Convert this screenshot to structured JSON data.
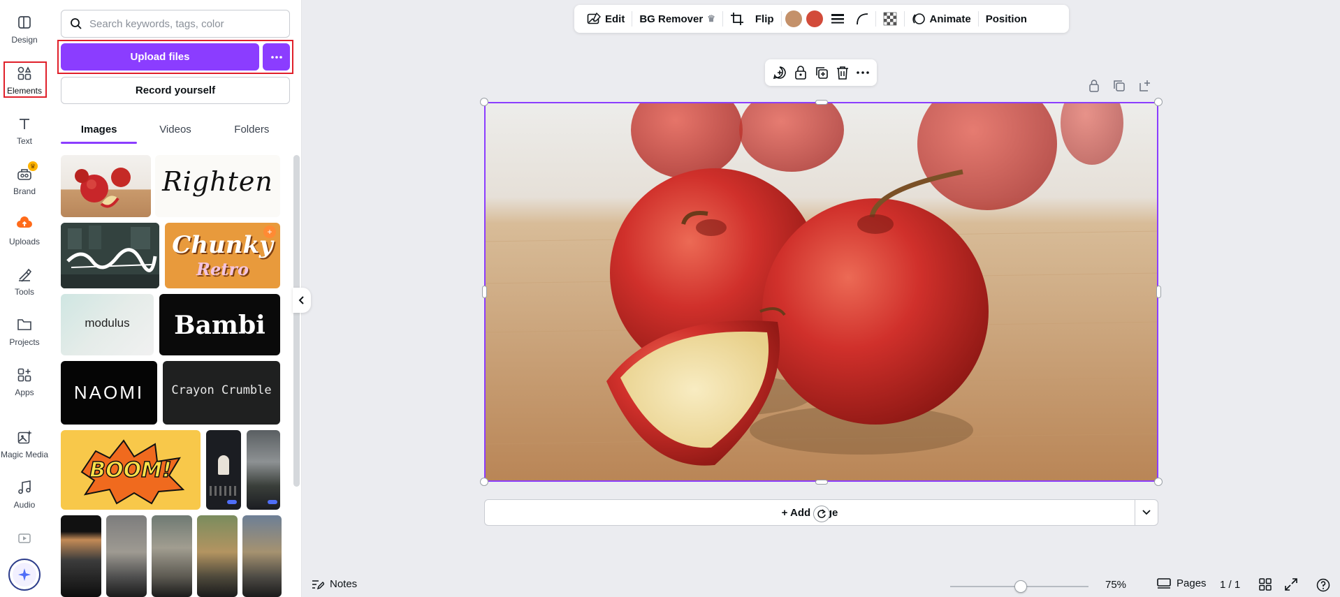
{
  "rail": {
    "items": [
      {
        "label": "Design",
        "icon": "design-icon"
      },
      {
        "label": "Elements",
        "icon": "elements-icon"
      },
      {
        "label": "Text",
        "icon": "text-icon"
      },
      {
        "label": "Brand",
        "icon": "brand-icon"
      },
      {
        "label": "Uploads",
        "icon": "uploads-icon"
      },
      {
        "label": "Tools",
        "icon": "tools-icon"
      },
      {
        "label": "Projects",
        "icon": "projects-icon"
      },
      {
        "label": "Apps",
        "icon": "apps-icon"
      },
      {
        "label": "Magic Media",
        "icon": "magic-media-icon"
      },
      {
        "label": "Audio",
        "icon": "audio-icon"
      }
    ]
  },
  "panel": {
    "search_placeholder": "Search keywords, tags, color",
    "upload_label": "Upload files",
    "record_label": "Record yourself",
    "tabs": [
      "Images",
      "Videos",
      "Folders"
    ],
    "active_tab": "Images",
    "thumbs": {
      "righten": "Righten",
      "chunky": "Chunky",
      "retro": "Retro",
      "modulus": "modulus",
      "bambi": "Bambi",
      "naomi": "NAOMI",
      "crayon": "Crayon Crumble",
      "boom": "BOOM!"
    }
  },
  "toolbar": {
    "edit": "Edit",
    "bg_remover": "BG Remover",
    "flip": "Flip",
    "animate": "Animate",
    "position": "Position",
    "swatch_colors": [
      "#c4916a",
      "#d24b3a"
    ]
  },
  "canvas": {
    "add_page": "+ Add page"
  },
  "bottom": {
    "notes": "Notes",
    "zoom": "75%",
    "zoom_fraction": 0.5,
    "pages": "Pages",
    "page_count": "1 / 1"
  },
  "colors": {
    "accent": "#8b3dff",
    "highlight": "#e0202a"
  }
}
